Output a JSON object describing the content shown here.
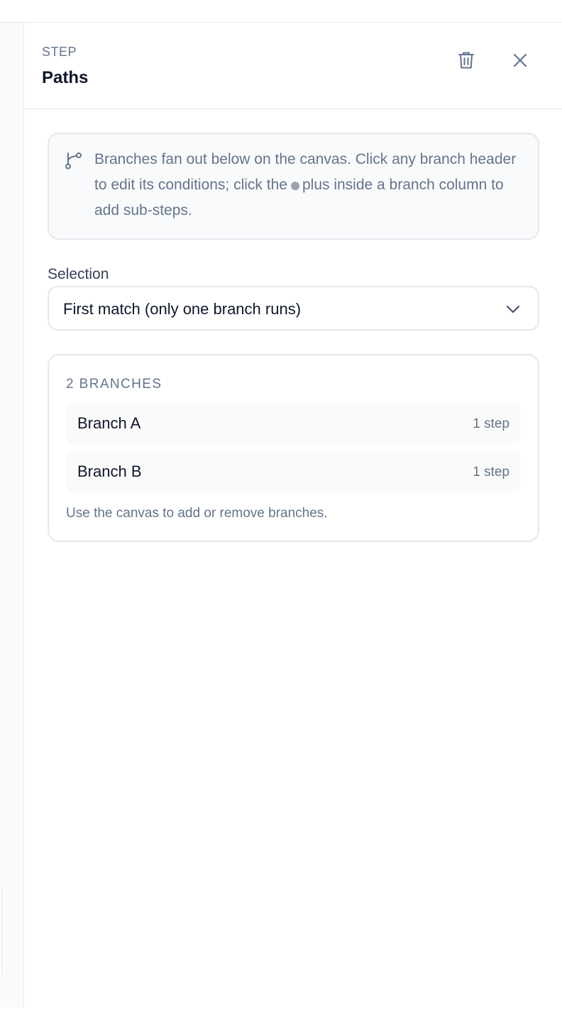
{
  "panel": {
    "kicker": "STEP",
    "title": "Paths"
  },
  "info": {
    "text_before_dot": "Branches fan out below on the canvas. Click any branch header to edit its conditions; click the",
    "text_after_dot": "plus inside a branch column to add sub-steps."
  },
  "selection": {
    "label": "Selection",
    "value": "First match (only one branch runs)"
  },
  "branches": {
    "heading": "2 BRANCHES",
    "items": [
      {
        "name": "Branch A",
        "count": "1 step"
      },
      {
        "name": "Branch B",
        "count": "1 step"
      }
    ],
    "hint": "Use the canvas to add or remove branches."
  },
  "icons": {
    "delete": "trash-icon",
    "close": "close-icon",
    "info": "branch-fork-icon",
    "select": "chevron-down-icon"
  },
  "colors": {
    "text_primary": "#0f172a",
    "text_muted": "#64748b",
    "border": "#e5e7eb",
    "info_bg": "#f9fafb",
    "row_bg": "#fafafa"
  }
}
